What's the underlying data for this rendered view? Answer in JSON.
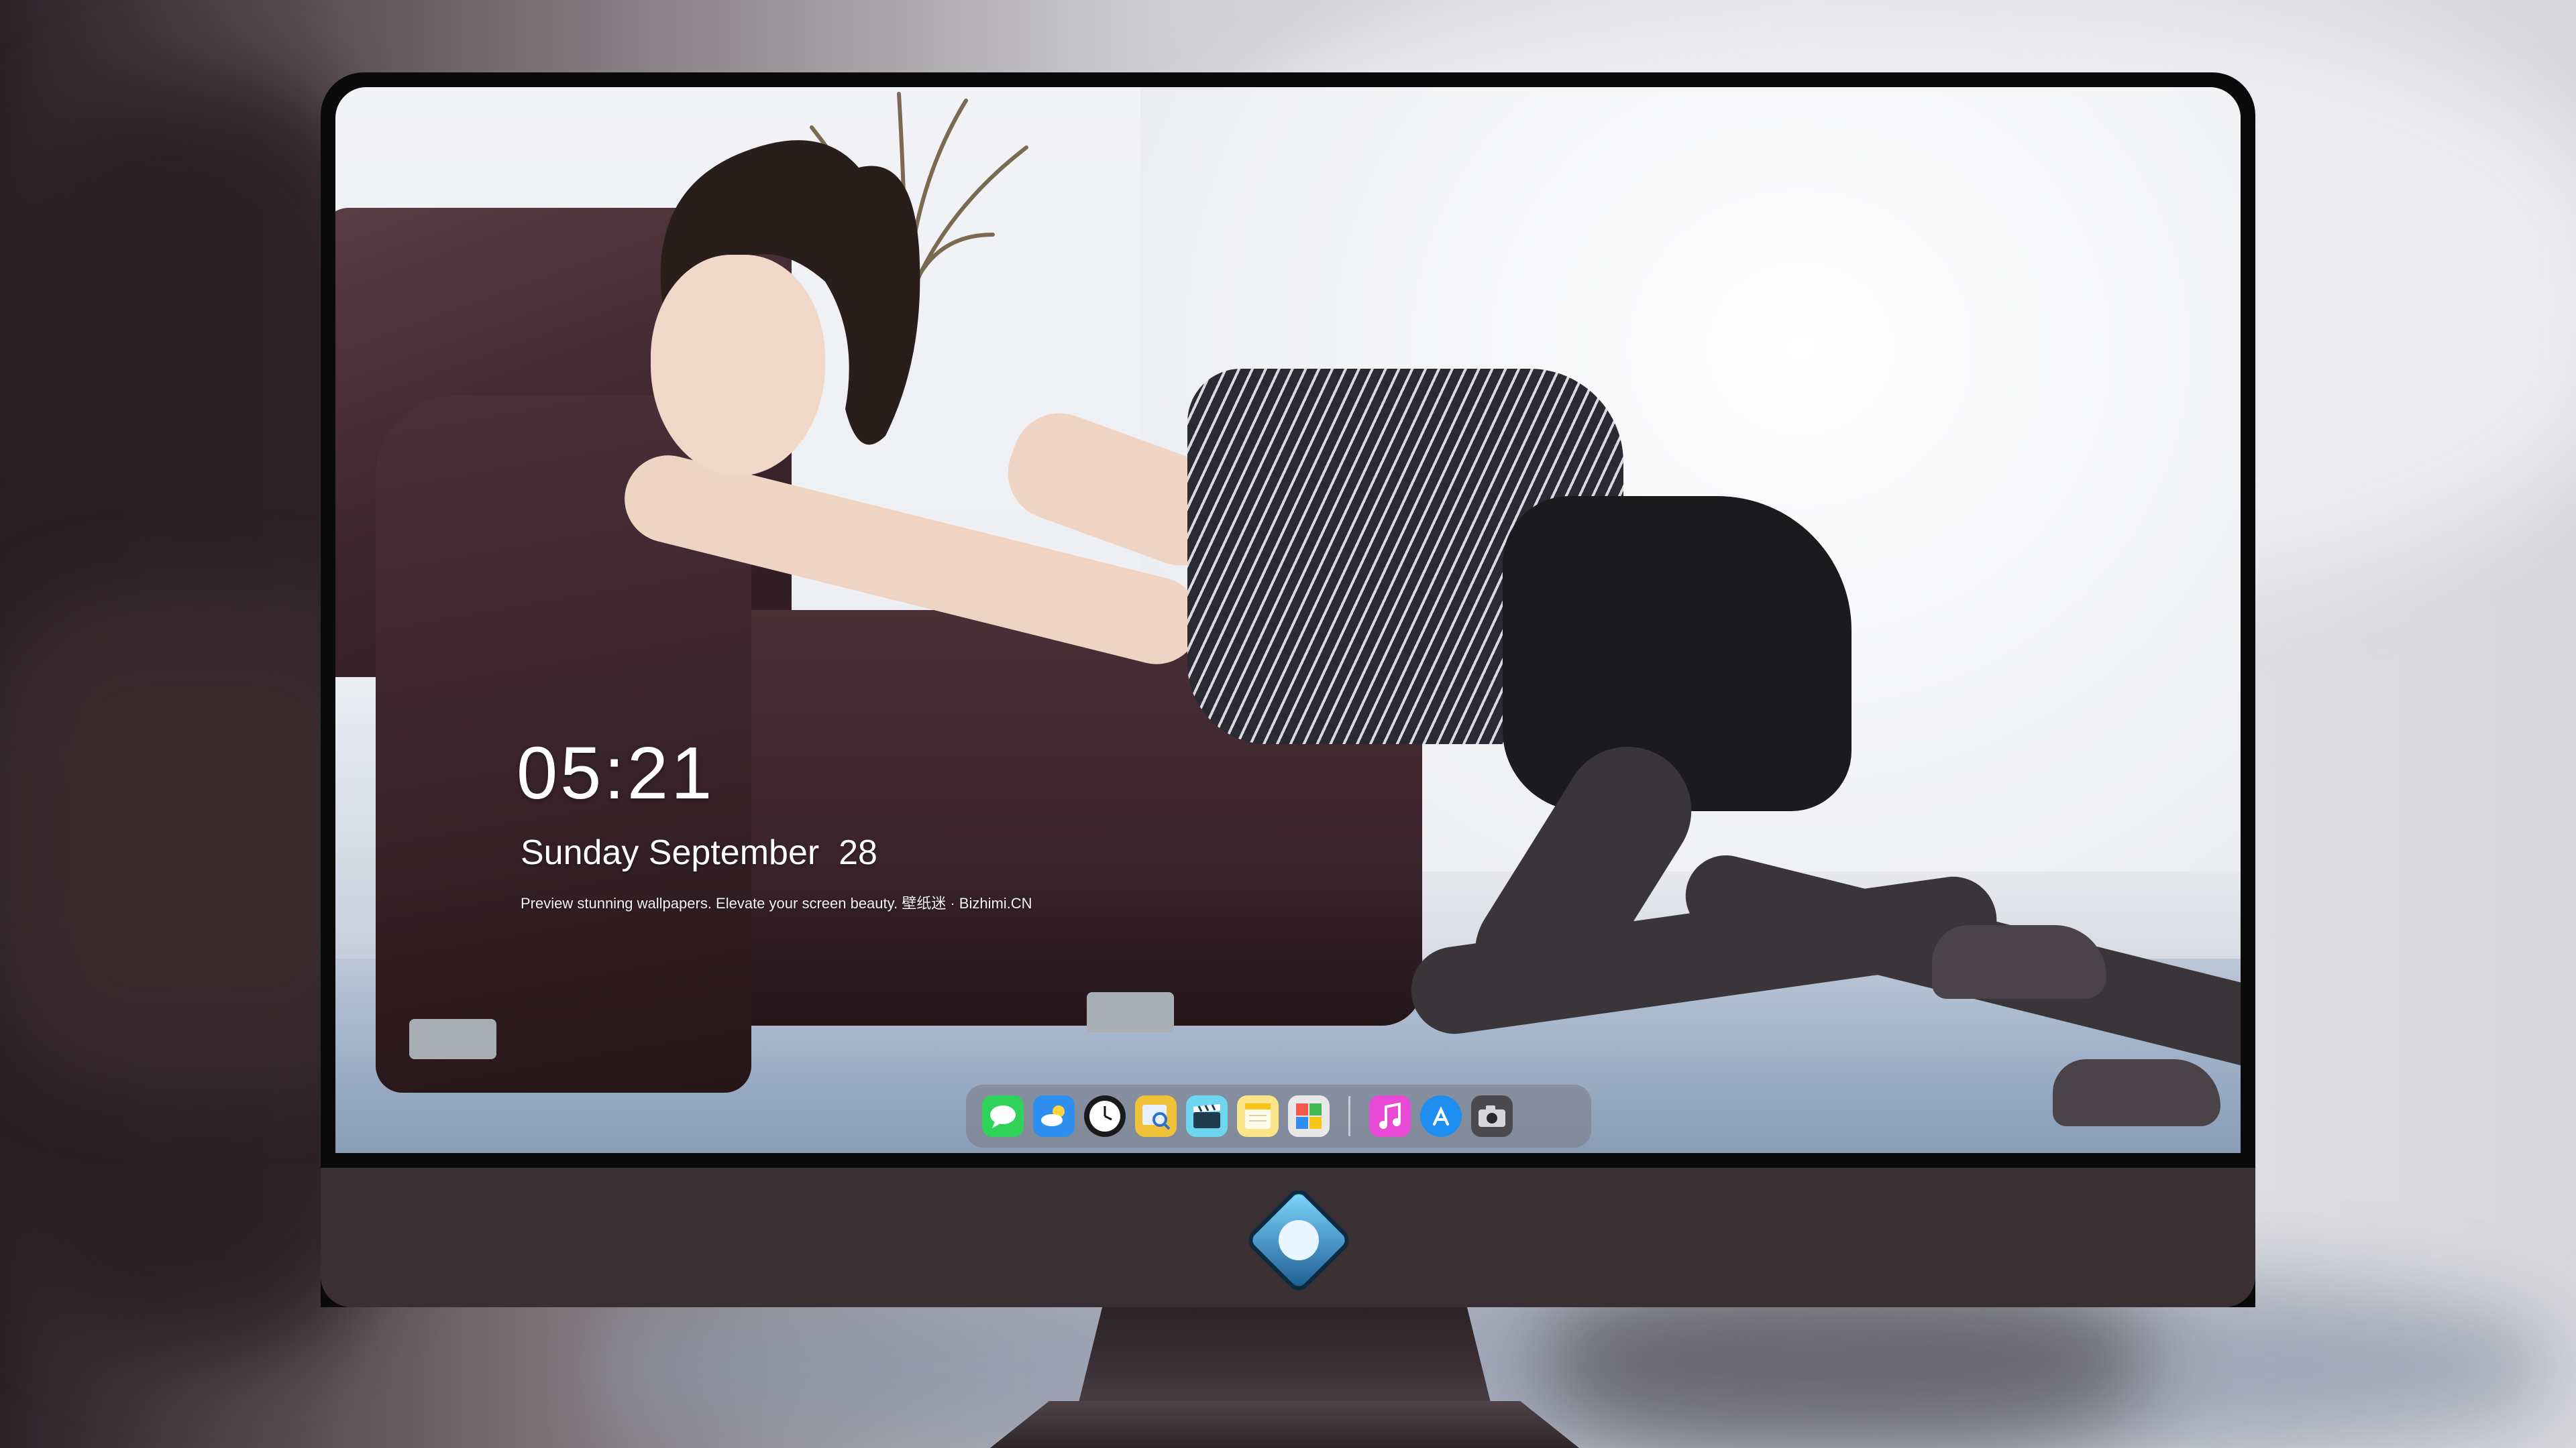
{
  "lockscreen": {
    "time": "05:21",
    "date": "Sunday September  28",
    "tagline": "Preview stunning wallpapers. Elevate your screen beauty. 壁纸迷 · Bizhimi.CN"
  },
  "dock": {
    "apps": [
      {
        "name": "messages",
        "icon": "message-bubble-icon",
        "color": "#2fd35a"
      },
      {
        "name": "weather",
        "icon": "cloud-sun-icon",
        "color": "#2f8ff0"
      },
      {
        "name": "clock",
        "icon": "clock-icon",
        "color": "#1a1a1a"
      },
      {
        "name": "preview",
        "icon": "magnifier-photo-icon",
        "color": "#f0c23a"
      },
      {
        "name": "video",
        "icon": "clapperboard-icon",
        "color": "#6fd6f0"
      },
      {
        "name": "notes",
        "icon": "notes-icon",
        "color": "#fbe58a"
      },
      {
        "name": "photo-booth",
        "icon": "photo-grid-icon",
        "color": "#e8e8e8"
      },
      {
        "name": "music",
        "icon": "music-note-icon",
        "color": "#e84ad6"
      },
      {
        "name": "app-store",
        "icon": "app-store-icon",
        "color": "#1e8ff0"
      },
      {
        "name": "camera",
        "icon": "camera-icon",
        "color": "#4a4a4e"
      }
    ]
  },
  "colors": {
    "monitor_bezel": "#0b0a0b",
    "monitor_chin": "#3a3034",
    "dock_bg": "rgba(120,122,132,.55)"
  }
}
